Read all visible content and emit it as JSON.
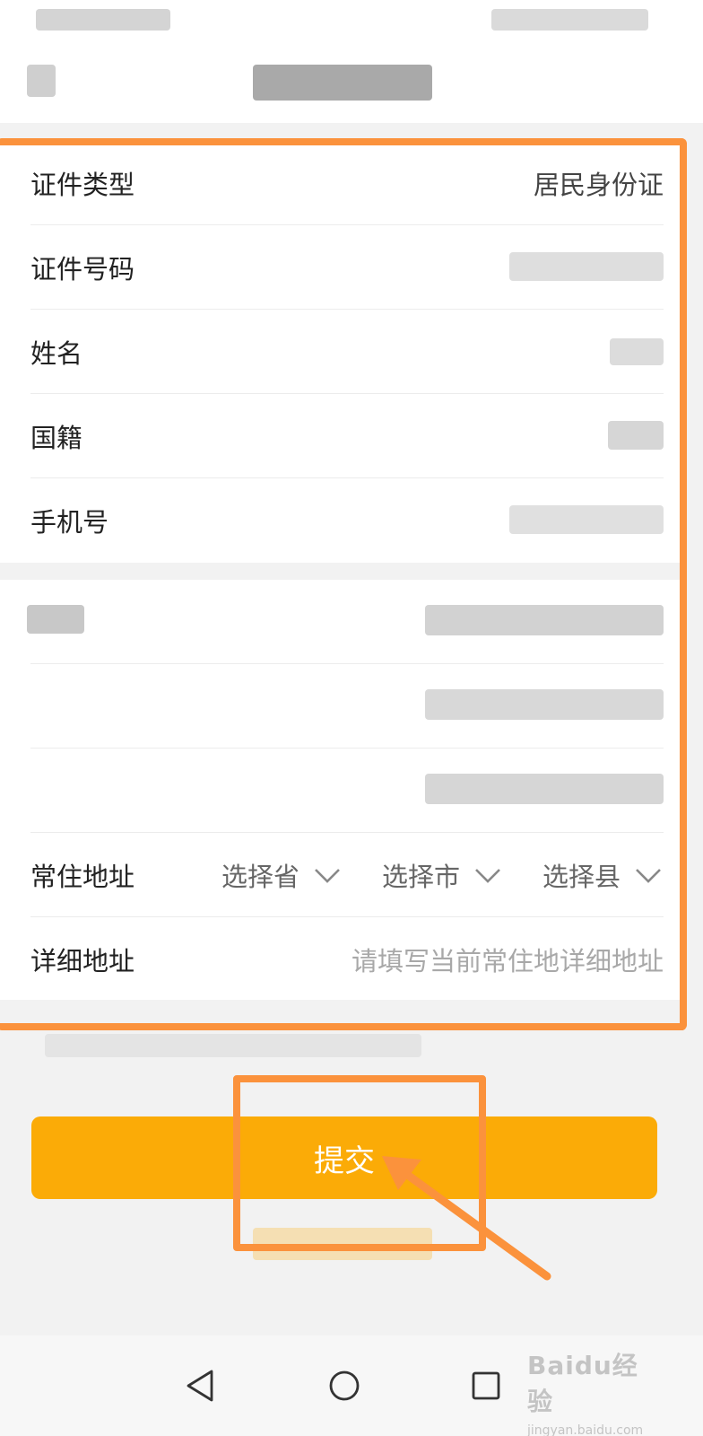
{
  "form": {
    "id_type": {
      "label": "证件类型",
      "value": "居民身份证"
    },
    "id_number": {
      "label": "证件号码"
    },
    "name": {
      "label": "姓名"
    },
    "nationality": {
      "label": "国籍"
    },
    "phone": {
      "label": "手机号"
    },
    "residence_address": {
      "label": "常住地址",
      "province_placeholder": "选择省",
      "city_placeholder": "选择市",
      "county_placeholder": "选择县"
    },
    "detail_address": {
      "label": "详细地址",
      "placeholder": "请填写当前常住地详细地址"
    }
  },
  "submit_label": "提交",
  "watermark": {
    "brand": "Baidu经验",
    "url": "jingyan.baidu.com"
  },
  "colors": {
    "accent": "#fbab07",
    "annotation": "#fb923c",
    "background": "#f2f2f2",
    "card": "#ffffff"
  }
}
